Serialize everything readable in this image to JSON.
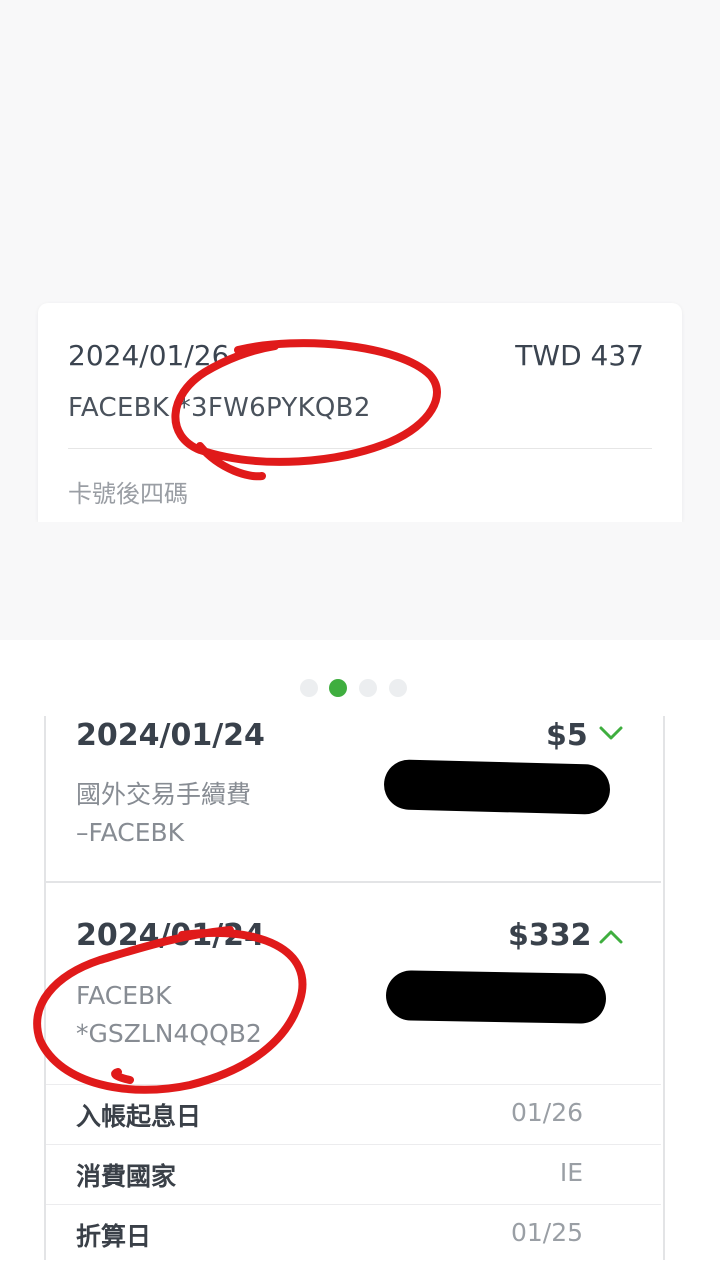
{
  "top_card": {
    "date": "2024/01/26",
    "amount": "TWD 437",
    "description": "FACEBK *3FW6PYKQB2",
    "card_last4_label": "卡號後四碼"
  },
  "pagination": {
    "count": 4,
    "active_index": 1
  },
  "transactions": [
    {
      "date": "2024/01/24",
      "amount": "$5",
      "desc_line1": "國外交易手續費",
      "desc_line2": "–FACEBK",
      "expanded": false
    },
    {
      "date": "2024/01/24",
      "amount": "$332",
      "desc_line1": "FACEBK",
      "desc_line2": "*GSZLN4QQB2",
      "expanded": true,
      "details": [
        {
          "label": "入帳起息日",
          "value": "01/26"
        },
        {
          "label": "消費國家",
          "value": "IE"
        },
        {
          "label": "折算日",
          "value": "01/25"
        }
      ]
    }
  ],
  "colors": {
    "accent_green": "#3fae3f",
    "annotation_red": "#e01a1a"
  },
  "icons": [
    "chevron-down-icon",
    "chevron-up-icon"
  ]
}
